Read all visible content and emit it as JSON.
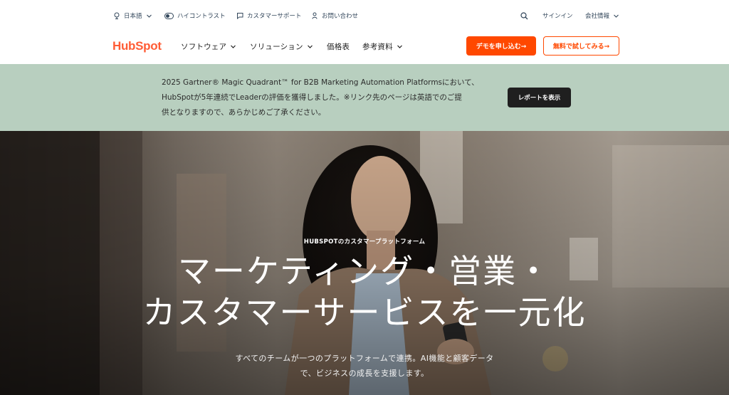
{
  "utility": {
    "language": "日本語",
    "contrast": "ハイコントラスト",
    "support": "カスタマーサポート",
    "contact": "お問い合わせ",
    "signin": "サインイン",
    "company": "会社情報"
  },
  "nav": {
    "logo": "HubSpot",
    "items": [
      {
        "label": "ソフトウェア"
      },
      {
        "label": "ソリューション"
      },
      {
        "label": "価格表"
      },
      {
        "label": "参考資料"
      }
    ],
    "demo_button": "デモを申し込む→",
    "free_button": "無料で試してみる→"
  },
  "banner": {
    "lines": [
      "2025 Gartner® Magic Quadrant™ for B2B Marketing Automation Platformsにおいて、",
      "HubSpotが5年連続でLeaderの評価を獲得しました。※リンク先のページは英語でのご提",
      "供となりますので、あらかじめご了承ください。"
    ],
    "button": "レポートを表示"
  },
  "hero": {
    "eyebrow": "HUBSPOTのカスタマープラットフォーム",
    "headline": [
      "マーケティング・営業・",
      "カスタマーサービスを一元化"
    ],
    "sub": [
      "すべてのチームが一つのプラットフォームで連携。AI機能と顧客データ",
      "で、ビジネスの成長を支援します。"
    ]
  },
  "colors": {
    "brand": "#ff5c35",
    "cta": "#ff4800",
    "banner_bg": "#b8cfbf",
    "dark_button": "#1f1f1f"
  }
}
